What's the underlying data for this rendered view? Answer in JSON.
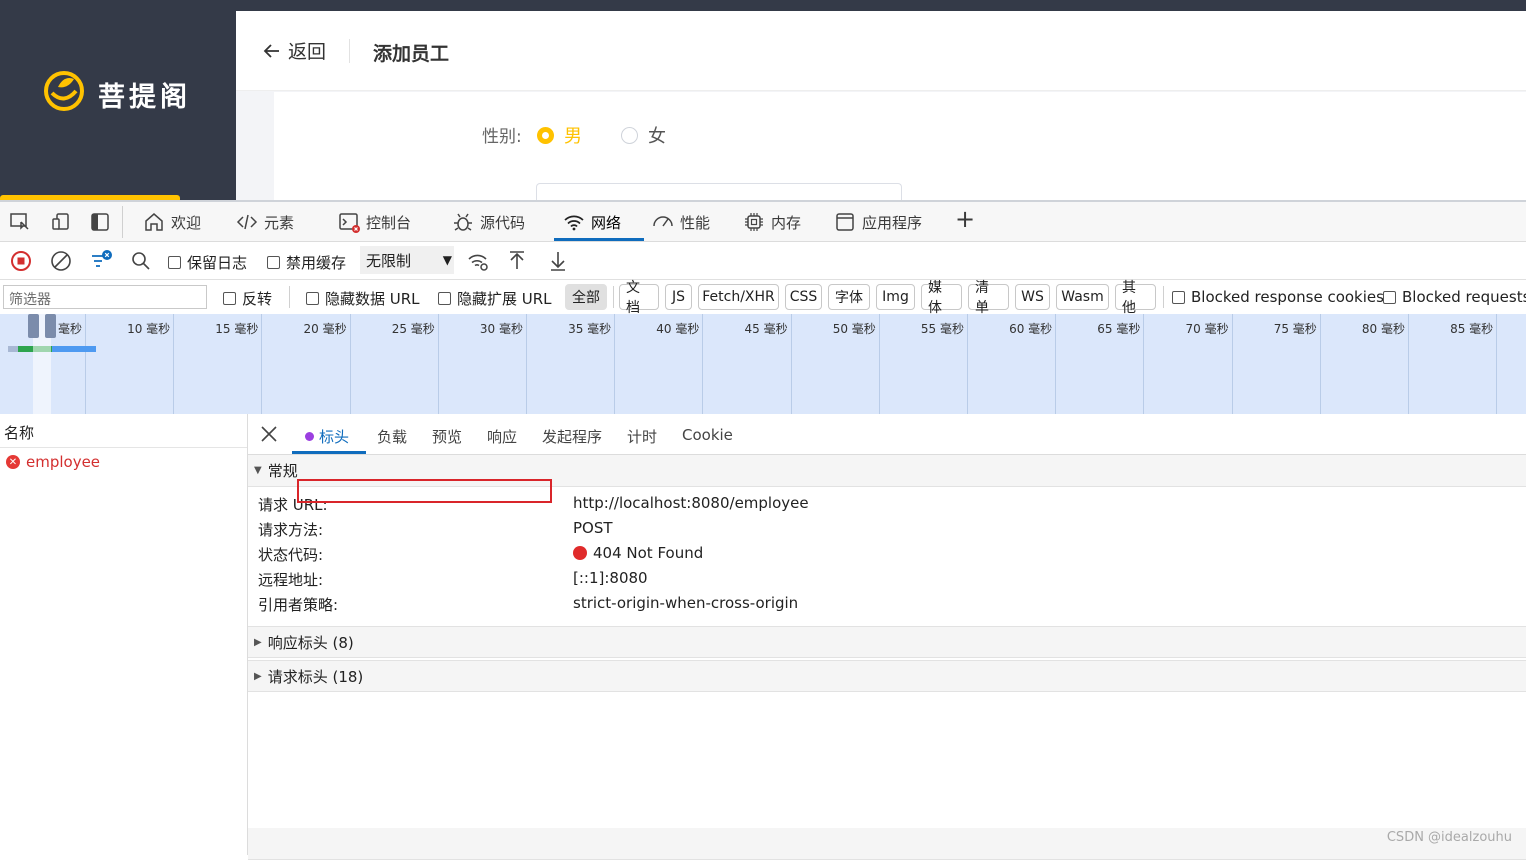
{
  "app": {
    "logo_text": "菩提阁",
    "back_label": "返回",
    "page_title": "添加员工",
    "gender_label": "性别:",
    "gender_options": [
      {
        "label": "男",
        "checked": true
      },
      {
        "label": "女",
        "checked": false
      }
    ],
    "accent_color": "#ffc200"
  },
  "devtools": {
    "tabs": [
      {
        "label": "欢迎",
        "icon": "home-icon"
      },
      {
        "label": "元素",
        "icon": "code-icon"
      },
      {
        "label": "控制台",
        "icon": "console-icon"
      },
      {
        "label": "源代码",
        "icon": "bug-icon"
      },
      {
        "label": "网络",
        "icon": "wifi-icon",
        "active": true
      },
      {
        "label": "性能",
        "icon": "gauge-icon"
      },
      {
        "label": "内存",
        "icon": "chip-icon"
      },
      {
        "label": "应用程序",
        "icon": "window-icon"
      }
    ],
    "add_tab_symbol": "+",
    "toolbar": {
      "preserve_log": "保留日志",
      "disable_cache": "禁用缓存",
      "throttling": "无限制"
    },
    "filter": {
      "placeholder": "筛选器",
      "invert": "反转",
      "hide_data_urls": "隐藏数据 URL",
      "hide_extension_urls": "隐藏扩展 URL",
      "types": [
        "全部",
        "文档",
        "JS",
        "Fetch/XHR",
        "CSS",
        "字体",
        "Img",
        "媒体",
        "清单",
        "WS",
        "Wasm",
        "其他"
      ],
      "blocked_response_cookies": "Blocked response cookies",
      "blocked_requests": "Blocked requests"
    },
    "timeline_ticks": [
      "毫秒",
      "10 毫秒",
      "15 毫秒",
      "20 毫秒",
      "25 毫秒",
      "30 毫秒",
      "35 毫秒",
      "40 毫秒",
      "45 毫秒",
      "50 毫秒",
      "55 毫秒",
      "60 毫秒",
      "65 毫秒",
      "70 毫秒",
      "75 毫秒",
      "80 毫秒",
      "85 毫秒"
    ],
    "request_list": {
      "header": "名称",
      "rows": [
        {
          "name": "employee",
          "error": true
        }
      ]
    },
    "detail": {
      "tabs": [
        "标头",
        "负载",
        "预览",
        "响应",
        "发起程序",
        "计时",
        "Cookie"
      ],
      "general_title": "常规",
      "general": [
        {
          "key": "请求 URL:",
          "value": "http://localhost:8080/employee"
        },
        {
          "key": "请求方法:",
          "value": "POST"
        },
        {
          "key": "状态代码:",
          "value": "404 Not Found"
        },
        {
          "key": "远程地址:",
          "value": "[::1]:8080"
        },
        {
          "key": "引用者策略:",
          "value": "strict-origin-when-cross-origin"
        }
      ],
      "response_headers": "响应标头 (8)",
      "request_headers": "请求标头 (18)"
    }
  },
  "watermark": "CSDN @idealzouhu"
}
